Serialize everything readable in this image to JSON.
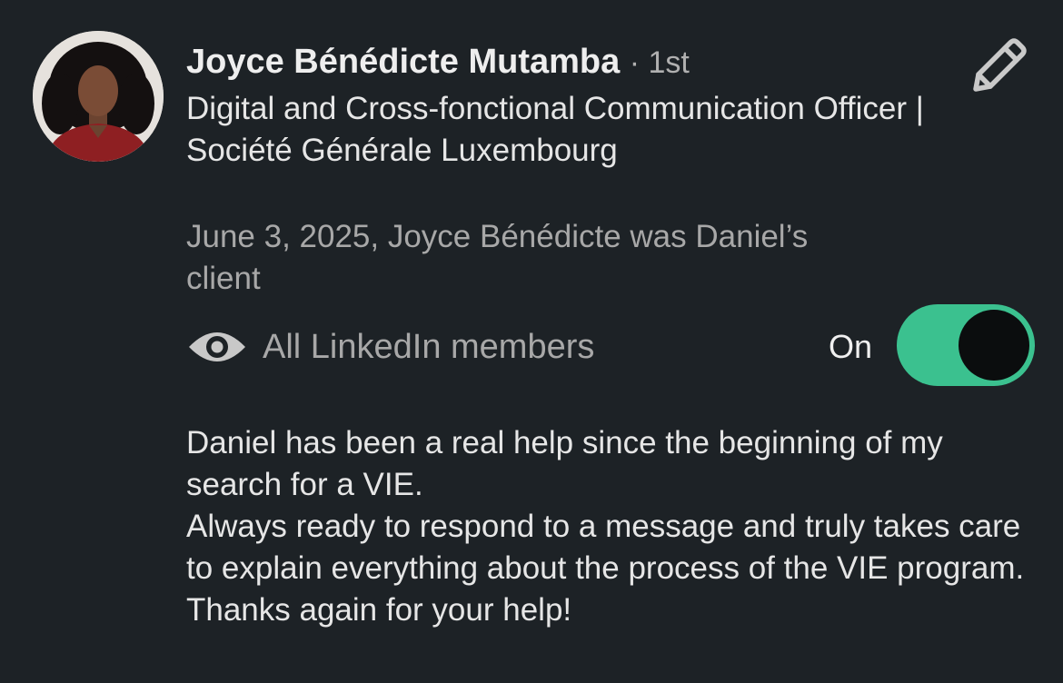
{
  "recommender": {
    "name": "Joyce Bénédicte Mutamba",
    "degree": "· 1st",
    "headline": "Digital and Cross-fonctional Communication Officer | Société Générale Luxembourg",
    "relationship": "June 3, 2025, Joyce Bénédicte was Daniel’s client",
    "avatar_icon": "profile-photo"
  },
  "actions": {
    "edit_icon": "pencil-icon"
  },
  "visibility": {
    "icon": "eye-icon",
    "label": "All LinkedIn members",
    "toggle_label": "On",
    "toggle_state": true,
    "toggle_color": "#3bc18f"
  },
  "recommendation": {
    "lines": [
      "Daniel has been a real help since the beginning of my search for a VIE.",
      "Always ready to respond to a message and truly takes care to explain everything about the process of the VIE program.",
      "Thanks again for your help!"
    ]
  },
  "colors": {
    "background": "#1d2226",
    "primary_text": "#e6e6e6",
    "secondary_text": "#a8a8a8",
    "accent": "#3bc18f"
  }
}
